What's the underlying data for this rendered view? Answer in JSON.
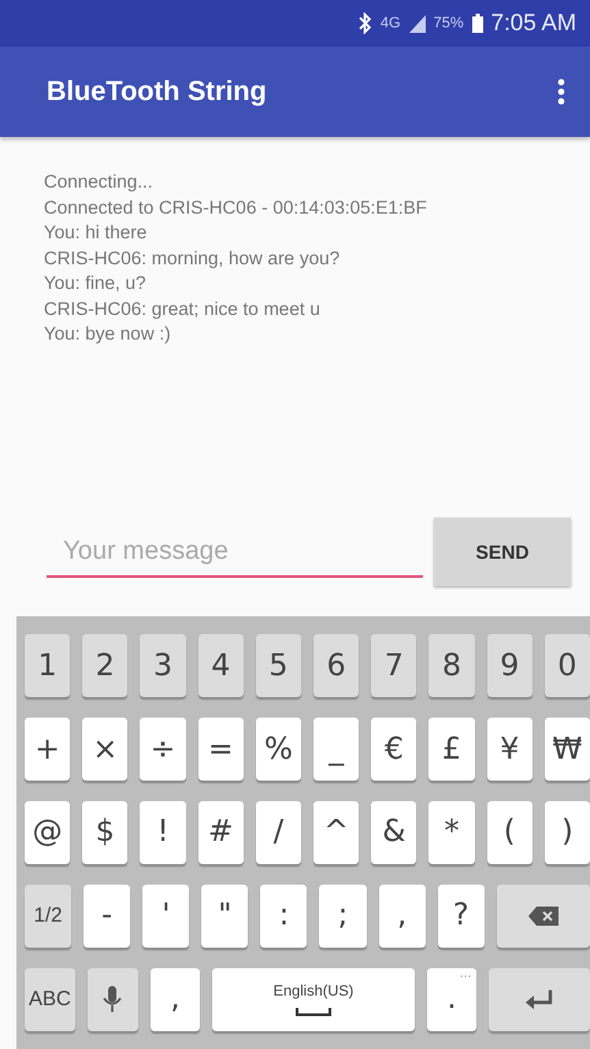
{
  "status_bar": {
    "network": "4G",
    "battery": "75%",
    "time": "7:05 AM"
  },
  "app_bar": {
    "title": "BlueTooth String"
  },
  "messages": [
    "Connecting...",
    "Connected to CRIS-HC06 - 00:14:03:05:E1:BF",
    "You: hi there",
    "CRIS-HC06: morning, how are you?",
    "You: fine, u?",
    "CRIS-HC06: great; nice to meet u",
    "You: bye now :)"
  ],
  "composer": {
    "placeholder": "Your message",
    "button": "SEND"
  },
  "keyboard": {
    "rows": [
      [
        {
          "kind": "dark",
          "label": "1"
        },
        {
          "kind": "dark",
          "label": "2"
        },
        {
          "kind": "dark",
          "label": "3"
        },
        {
          "kind": "dark",
          "label": "4"
        },
        {
          "kind": "dark",
          "label": "5"
        },
        {
          "kind": "dark",
          "label": "6"
        },
        {
          "kind": "dark",
          "label": "7"
        },
        {
          "kind": "dark",
          "label": "8"
        },
        {
          "kind": "dark",
          "label": "9"
        },
        {
          "kind": "dark",
          "label": "0"
        }
      ],
      [
        {
          "kind": "light",
          "label": "+"
        },
        {
          "kind": "light",
          "label": "×"
        },
        {
          "kind": "light",
          "label": "÷"
        },
        {
          "kind": "light",
          "label": "="
        },
        {
          "kind": "light",
          "label": "%"
        },
        {
          "kind": "light",
          "label": "_"
        },
        {
          "kind": "light",
          "label": "€"
        },
        {
          "kind": "light",
          "label": "£"
        },
        {
          "kind": "light",
          "label": "¥"
        },
        {
          "kind": "light",
          "label": "₩"
        }
      ],
      [
        {
          "kind": "light",
          "label": "@"
        },
        {
          "kind": "light",
          "label": "$"
        },
        {
          "kind": "light",
          "label": "!"
        },
        {
          "kind": "light",
          "label": "#"
        },
        {
          "kind": "light",
          "label": "/"
        },
        {
          "kind": "light",
          "label": "^"
        },
        {
          "kind": "light",
          "label": "&"
        },
        {
          "kind": "light",
          "label": "*"
        },
        {
          "kind": "light",
          "label": "("
        },
        {
          "kind": "light",
          "label": ")"
        }
      ],
      [
        {
          "kind": "dark",
          "label": "1/2"
        },
        {
          "kind": "light",
          "label": "-"
        },
        {
          "kind": "light",
          "label": "'"
        },
        {
          "kind": "light",
          "label": "\""
        },
        {
          "kind": "light",
          "label": ":"
        },
        {
          "kind": "light",
          "label": ";"
        },
        {
          "kind": "light",
          "label": ","
        },
        {
          "kind": "light",
          "label": "?"
        },
        {
          "kind": "backspace"
        }
      ]
    ],
    "bottom_row": {
      "keys": [
        {
          "kind": "dark",
          "label": "ABC"
        },
        {
          "kind": "mic"
        },
        {
          "kind": "light",
          "label": ","
        },
        {
          "kind": "space",
          "label": "English(US)"
        },
        {
          "kind": "light",
          "label": ".",
          "hint": "···"
        },
        {
          "kind": "enter"
        }
      ]
    }
  }
}
